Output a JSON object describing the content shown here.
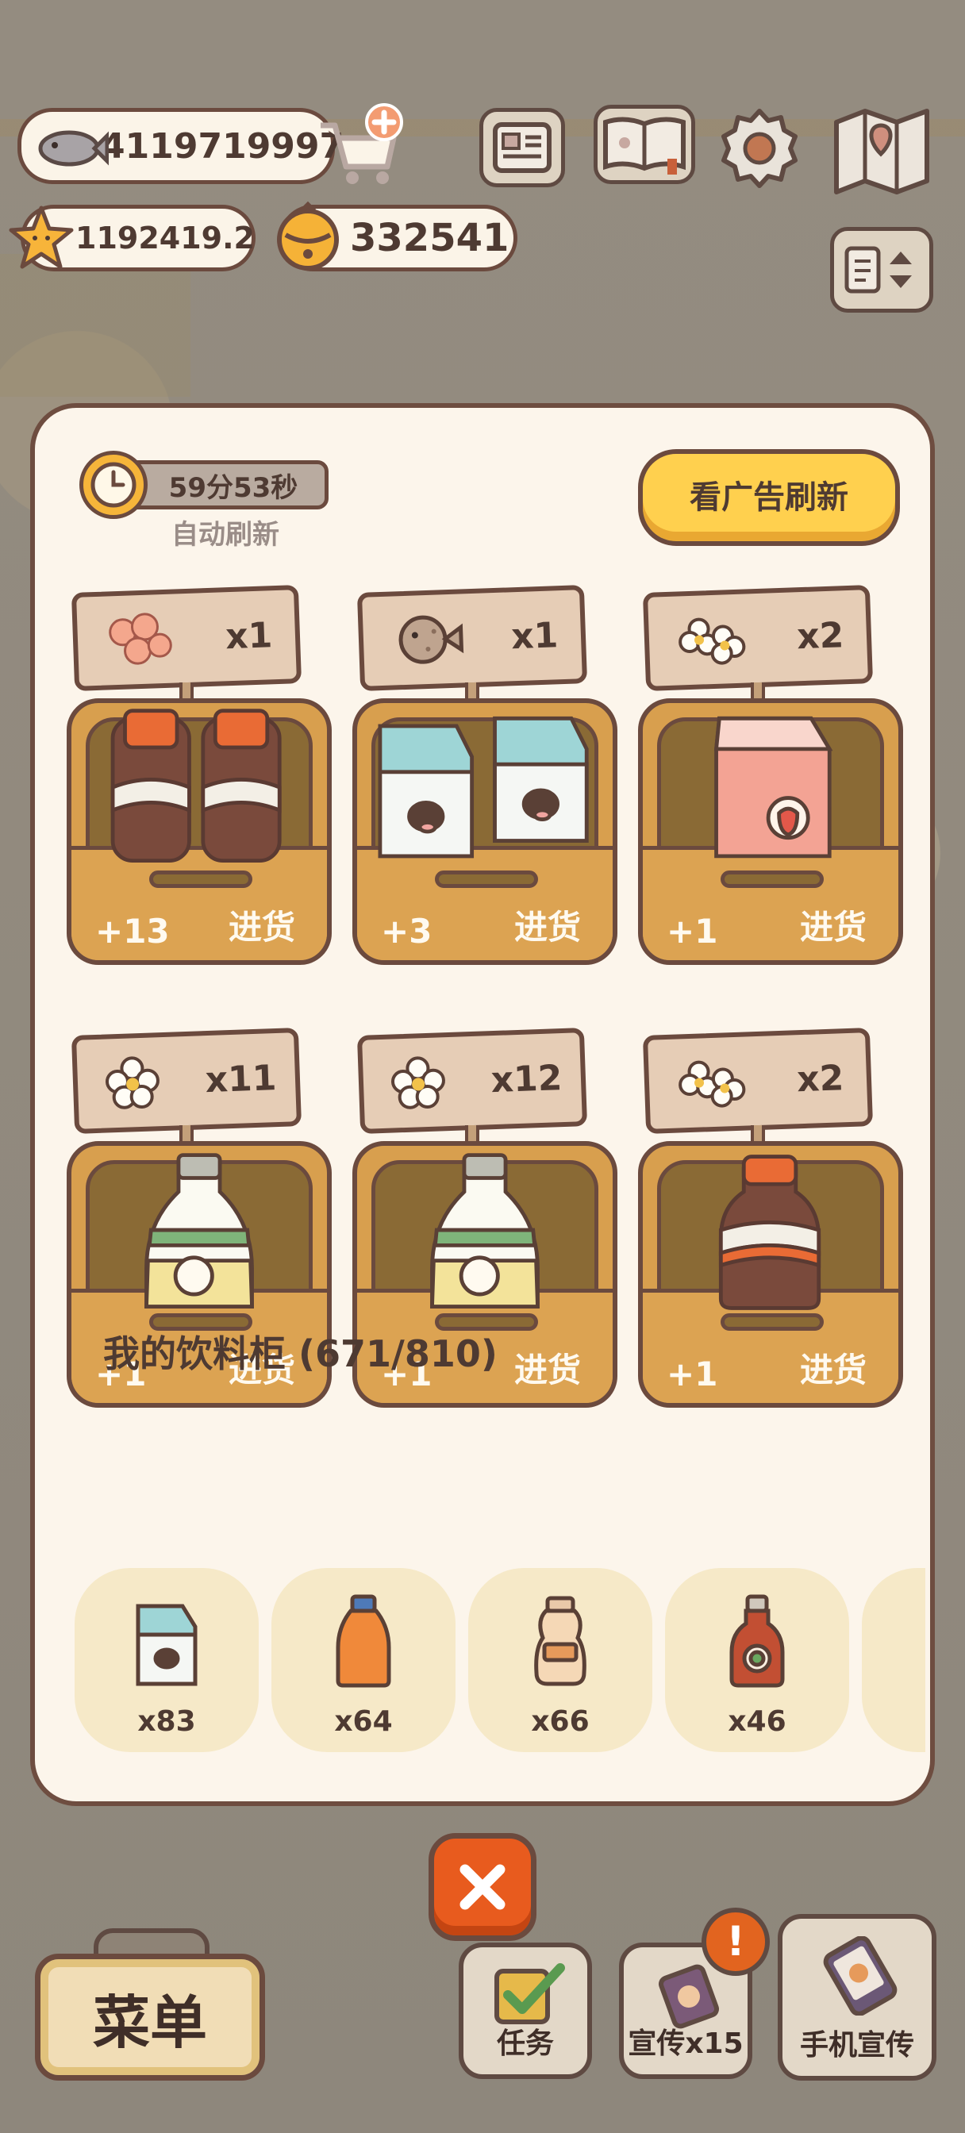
{
  "hud": {
    "fish_count": "4119719997",
    "star_count": "1192419.2",
    "bell_count": "332541",
    "icons": [
      "fish-icon",
      "cart-add-icon",
      "star-icon",
      "bell-icon",
      "newspaper-icon",
      "paw-book-icon",
      "gear-icon",
      "map-icon",
      "sort-toggle-icon"
    ]
  },
  "panel": {
    "timer": "59分53秒",
    "auto_refresh_label": "自动刷新",
    "ad_refresh_label": "看广告刷新",
    "restock_label": "进货",
    "slots": [
      {
        "currency": "flower-cluster-icon",
        "cost": "x1",
        "bonus": "+13",
        "product": "cola-bottles"
      },
      {
        "currency": "pufferfish-icon",
        "cost": "x1",
        "bonus": "+3",
        "product": "milk-cartons"
      },
      {
        "currency": "white-flowers-icon",
        "cost": "x2",
        "bonus": "+1",
        "product": "strawberry-milk"
      },
      {
        "currency": "white-flower-icon",
        "cost": "x11",
        "bonus": "+1",
        "product": "lemon-soda"
      },
      {
        "currency": "white-flower-icon",
        "cost": "x12",
        "bonus": "+1",
        "product": "lemon-soda"
      },
      {
        "currency": "white-flowers-icon",
        "cost": "x2",
        "bonus": "+1",
        "product": "cola-bottle"
      }
    ],
    "cabinet_title": "我的饮料柜 (671/810)",
    "inventory": [
      {
        "item": "milk-carton-icon",
        "count": "x83"
      },
      {
        "item": "orange-juice-icon",
        "count": "x64"
      },
      {
        "item": "yogurt-drink-icon",
        "count": "x66"
      },
      {
        "item": "peach-juice-icon",
        "count": "x46"
      }
    ]
  },
  "bottom": {
    "menu_label": "菜单",
    "tasks_label": "任务",
    "promo_label": "宣传x15",
    "promo_badge": "!",
    "phone_promo_label": "手机宣传"
  }
}
